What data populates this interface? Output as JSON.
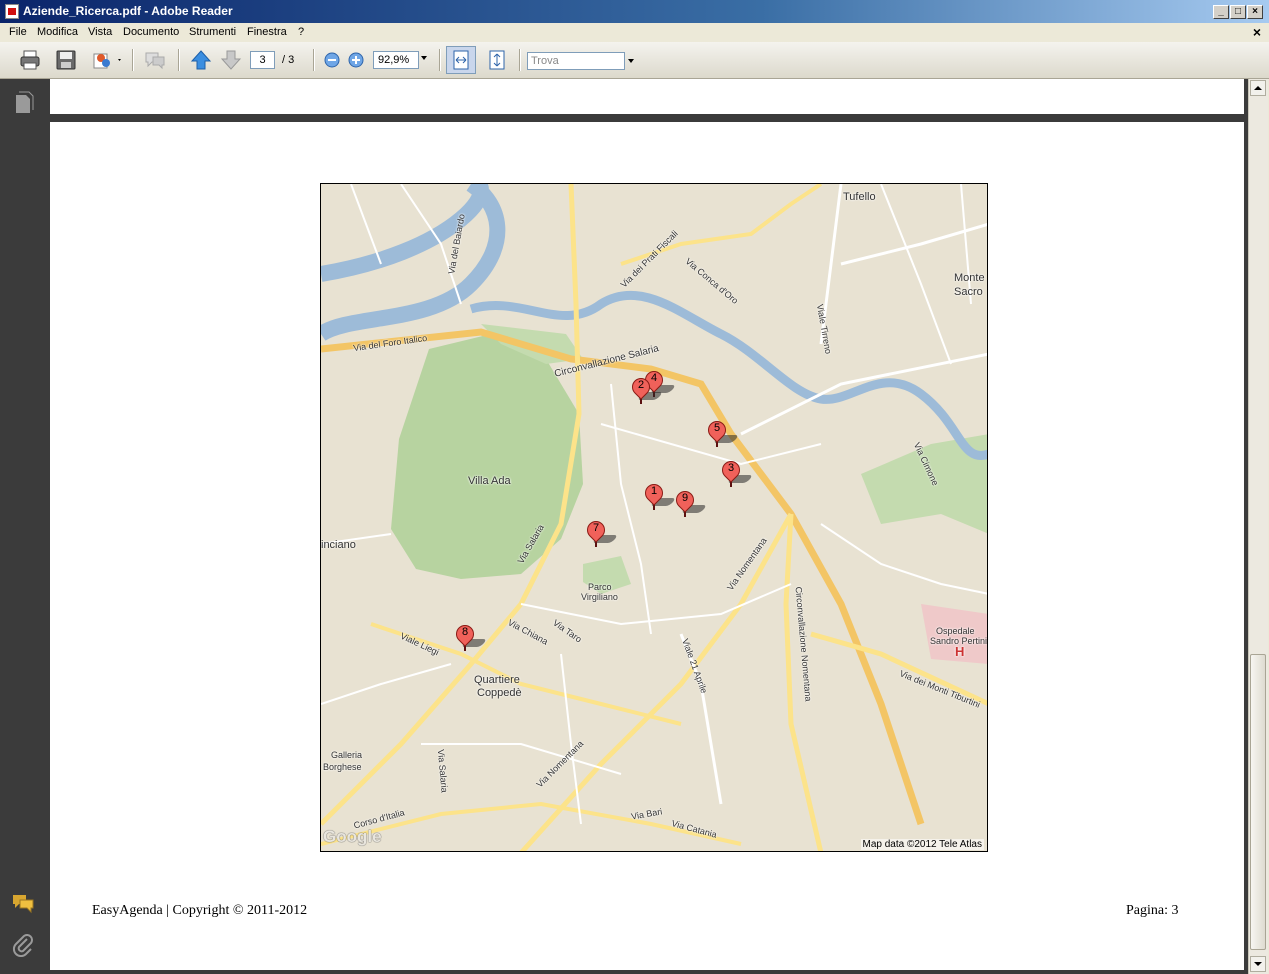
{
  "window": {
    "title": "Aziende_Ricerca.pdf - Adobe Reader",
    "minimize": "_",
    "maximize": "□",
    "close": "×"
  },
  "menu": {
    "items": [
      "File",
      "Modifica",
      "Vista",
      "Documento",
      "Strumenti",
      "Finestra",
      "?"
    ],
    "close_doc": "×"
  },
  "toolbar": {
    "icons": [
      "print-icon",
      "save-icon",
      "collaborate-icon",
      "comment-icon",
      "previous-page-icon",
      "next-page-icon",
      "zoom-out-icon",
      "zoom-in-icon",
      "fit-width-icon",
      "fit-page-icon"
    ],
    "page_current": "3",
    "page_total": "/ 3",
    "zoom": "92,9%",
    "find_placeholder": "Trova"
  },
  "left_pane": {
    "icons": [
      "pages-icon",
      "comments-icon",
      "attachments-icon"
    ]
  },
  "map": {
    "places": {
      "tufello": "Tufello",
      "monte_sacro_1": "Monte",
      "monte_sacro_2": "Sacro",
      "villa_ada": "Villa Ada",
      "parco_virgiliano_1": "Parco",
      "parco_virgiliano_2": "Virgiliano",
      "quartiere_coppede_1": "Quartiere",
      "quartiere_coppede_2": "Coppedè",
      "galleria_borghese_1": "Galleria",
      "galleria_borghese_2": "Borghese",
      "ospedale_1": "Ospedale",
      "ospedale_2": "Sandro Pertini",
      "pinciano": "inciano"
    },
    "roads": {
      "via_del_foro_italico": "Via del Foro Italico",
      "circonvallazione_salaria": "Circonvallazione Salaria",
      "via_dei_prati_fiscali": "Via dei Prati Fiscali",
      "via_conca_doro": "Via Conca d'Oro",
      "viale_tirreno": "Viale Tirreno",
      "via_cimone": "Via Cimone",
      "via_salaria": "Via Salaria",
      "via_nomentana": "Via Nomentana",
      "circonvallazione_nomentana": "Circonvallazione Nomentana",
      "viale_liegi": "Viale Liegi",
      "via_chiana": "Via Chiana",
      "via_taro": "Via Taro",
      "viale_21_aprile": "Viale 21 Aprile",
      "via_dei_monti_tiburtini": "Via dei Monti Tiburtini",
      "via_nomentana_2": "Via Nomentana",
      "corso_ditalia": "Corso d'Italia",
      "via_bari": "Via Bari",
      "via_catania": "Via Catania",
      "via_salaria_2": "Via Salaria",
      "via_del_baiardo": "Via del Baiardo",
      "hospital": "H"
    },
    "markers": [
      {
        "label": "1"
      },
      {
        "label": "2"
      },
      {
        "label": "3"
      },
      {
        "label": "4"
      },
      {
        "label": "5"
      },
      {
        "label": "7"
      },
      {
        "label": "8"
      },
      {
        "label": "9"
      }
    ],
    "google_logo": "Google",
    "attribution": "Map data ©2012 Tele Atlas"
  },
  "footer": {
    "left": "EasyAgenda | Copyright © 2011-2012",
    "right": "Pagina: 3"
  }
}
